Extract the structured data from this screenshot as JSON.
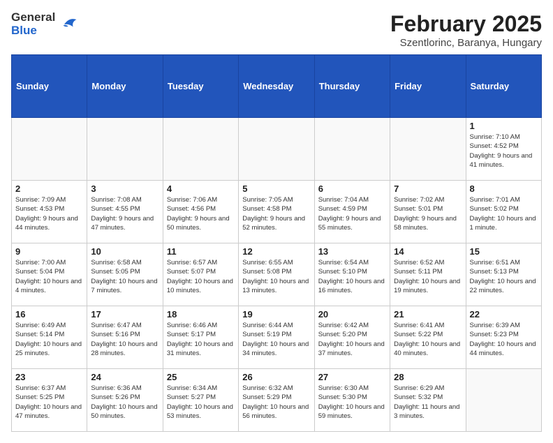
{
  "logo": {
    "general": "General",
    "blue": "Blue"
  },
  "title": "February 2025",
  "location": "Szentlorinc, Baranya, Hungary",
  "weekdays": [
    "Sunday",
    "Monday",
    "Tuesday",
    "Wednesday",
    "Thursday",
    "Friday",
    "Saturday"
  ],
  "weeks": [
    [
      {
        "day": "",
        "info": ""
      },
      {
        "day": "",
        "info": ""
      },
      {
        "day": "",
        "info": ""
      },
      {
        "day": "",
        "info": ""
      },
      {
        "day": "",
        "info": ""
      },
      {
        "day": "",
        "info": ""
      },
      {
        "day": "1",
        "info": "Sunrise: 7:10 AM\nSunset: 4:52 PM\nDaylight: 9 hours and 41 minutes."
      }
    ],
    [
      {
        "day": "2",
        "info": "Sunrise: 7:09 AM\nSunset: 4:53 PM\nDaylight: 9 hours and 44 minutes."
      },
      {
        "day": "3",
        "info": "Sunrise: 7:08 AM\nSunset: 4:55 PM\nDaylight: 9 hours and 47 minutes."
      },
      {
        "day": "4",
        "info": "Sunrise: 7:06 AM\nSunset: 4:56 PM\nDaylight: 9 hours and 50 minutes."
      },
      {
        "day": "5",
        "info": "Sunrise: 7:05 AM\nSunset: 4:58 PM\nDaylight: 9 hours and 52 minutes."
      },
      {
        "day": "6",
        "info": "Sunrise: 7:04 AM\nSunset: 4:59 PM\nDaylight: 9 hours and 55 minutes."
      },
      {
        "day": "7",
        "info": "Sunrise: 7:02 AM\nSunset: 5:01 PM\nDaylight: 9 hours and 58 minutes."
      },
      {
        "day": "8",
        "info": "Sunrise: 7:01 AM\nSunset: 5:02 PM\nDaylight: 10 hours and 1 minute."
      }
    ],
    [
      {
        "day": "9",
        "info": "Sunrise: 7:00 AM\nSunset: 5:04 PM\nDaylight: 10 hours and 4 minutes."
      },
      {
        "day": "10",
        "info": "Sunrise: 6:58 AM\nSunset: 5:05 PM\nDaylight: 10 hours and 7 minutes."
      },
      {
        "day": "11",
        "info": "Sunrise: 6:57 AM\nSunset: 5:07 PM\nDaylight: 10 hours and 10 minutes."
      },
      {
        "day": "12",
        "info": "Sunrise: 6:55 AM\nSunset: 5:08 PM\nDaylight: 10 hours and 13 minutes."
      },
      {
        "day": "13",
        "info": "Sunrise: 6:54 AM\nSunset: 5:10 PM\nDaylight: 10 hours and 16 minutes."
      },
      {
        "day": "14",
        "info": "Sunrise: 6:52 AM\nSunset: 5:11 PM\nDaylight: 10 hours and 19 minutes."
      },
      {
        "day": "15",
        "info": "Sunrise: 6:51 AM\nSunset: 5:13 PM\nDaylight: 10 hours and 22 minutes."
      }
    ],
    [
      {
        "day": "16",
        "info": "Sunrise: 6:49 AM\nSunset: 5:14 PM\nDaylight: 10 hours and 25 minutes."
      },
      {
        "day": "17",
        "info": "Sunrise: 6:47 AM\nSunset: 5:16 PM\nDaylight: 10 hours and 28 minutes."
      },
      {
        "day": "18",
        "info": "Sunrise: 6:46 AM\nSunset: 5:17 PM\nDaylight: 10 hours and 31 minutes."
      },
      {
        "day": "19",
        "info": "Sunrise: 6:44 AM\nSunset: 5:19 PM\nDaylight: 10 hours and 34 minutes."
      },
      {
        "day": "20",
        "info": "Sunrise: 6:42 AM\nSunset: 5:20 PM\nDaylight: 10 hours and 37 minutes."
      },
      {
        "day": "21",
        "info": "Sunrise: 6:41 AM\nSunset: 5:22 PM\nDaylight: 10 hours and 40 minutes."
      },
      {
        "day": "22",
        "info": "Sunrise: 6:39 AM\nSunset: 5:23 PM\nDaylight: 10 hours and 44 minutes."
      }
    ],
    [
      {
        "day": "23",
        "info": "Sunrise: 6:37 AM\nSunset: 5:25 PM\nDaylight: 10 hours and 47 minutes."
      },
      {
        "day": "24",
        "info": "Sunrise: 6:36 AM\nSunset: 5:26 PM\nDaylight: 10 hours and 50 minutes."
      },
      {
        "day": "25",
        "info": "Sunrise: 6:34 AM\nSunset: 5:27 PM\nDaylight: 10 hours and 53 minutes."
      },
      {
        "day": "26",
        "info": "Sunrise: 6:32 AM\nSunset: 5:29 PM\nDaylight: 10 hours and 56 minutes."
      },
      {
        "day": "27",
        "info": "Sunrise: 6:30 AM\nSunset: 5:30 PM\nDaylight: 10 hours and 59 minutes."
      },
      {
        "day": "28",
        "info": "Sunrise: 6:29 AM\nSunset: 5:32 PM\nDaylight: 11 hours and 3 minutes."
      },
      {
        "day": "",
        "info": ""
      }
    ]
  ]
}
